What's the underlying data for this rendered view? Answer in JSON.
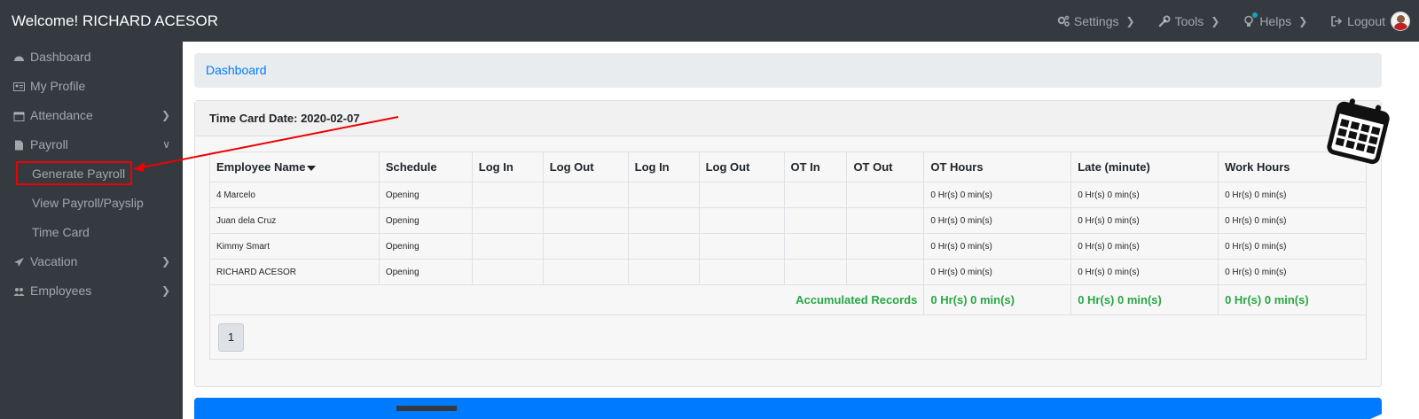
{
  "topbar": {
    "title": "Welcome! RICHARD ACESOR",
    "nav": [
      {
        "label": "Settings",
        "icon": "gears-icon"
      },
      {
        "label": "Tools",
        "icon": "wrench-icon"
      },
      {
        "label": "Helps",
        "icon": "lightbulb-icon"
      },
      {
        "label": "Logout",
        "icon": "sign-out-icon"
      }
    ]
  },
  "sidebar": {
    "items": [
      {
        "label": "Dashboard",
        "icon": "dashboard-icon"
      },
      {
        "label": "My Profile",
        "icon": "id-card-icon"
      },
      {
        "label": "Attendance",
        "icon": "calendar-icon"
      },
      {
        "label": "Payroll",
        "icon": "file-icon"
      },
      {
        "label": "Vacation",
        "icon": "plane-icon"
      },
      {
        "label": "Employees",
        "icon": "users-icon"
      }
    ],
    "payroll_sub": [
      "Generate Payroll",
      "View Payroll/Payslip",
      "Time Card"
    ]
  },
  "breadcrumb": {
    "label": "Dashboard"
  },
  "timecard": {
    "title": "Time Card Date: 2020-02-07",
    "columns": [
      "Employee Name",
      "Schedule",
      "Log In",
      "Log Out",
      "Log In",
      "Log Out",
      "OT In",
      "OT Out",
      "OT Hours",
      "Late (minute)",
      "Work Hours"
    ],
    "rows": [
      [
        "4 Marcelo",
        "Opening",
        "",
        "",
        "",
        "",
        "",
        "",
        "0 Hr(s) 0 min(s)",
        "0 Hr(s) 0 min(s)",
        "0 Hr(s) 0 min(s)"
      ],
      [
        "Juan dela Cruz",
        "Opening",
        "",
        "",
        "",
        "",
        "",
        "",
        "0 Hr(s) 0 min(s)",
        "0 Hr(s) 0 min(s)",
        "0 Hr(s) 0 min(s)"
      ],
      [
        "Kimmy Smart",
        "Opening",
        "",
        "",
        "",
        "",
        "",
        "",
        "0 Hr(s) 0 min(s)",
        "0 Hr(s) 0 min(s)",
        "0 Hr(s) 0 min(s)"
      ],
      [
        "RICHARD ACESOR",
        "Opening",
        "",
        "",
        "",
        "",
        "",
        "",
        "0 Hr(s) 0 min(s)",
        "0 Hr(s) 0 min(s)",
        "0 Hr(s) 0 min(s)"
      ]
    ],
    "accumulated": {
      "label": "Accumulated Records",
      "ot_hours": "0 Hr(s) 0 min(s)",
      "late": "0 Hr(s) 0 min(s)",
      "work_hours": "0 Hr(s) 0 min(s)"
    },
    "page": "1"
  },
  "colors": {
    "topbar": "#343a40",
    "link": "#007bff",
    "accent_green": "#28a745",
    "annotation_red": "#e00000"
  }
}
